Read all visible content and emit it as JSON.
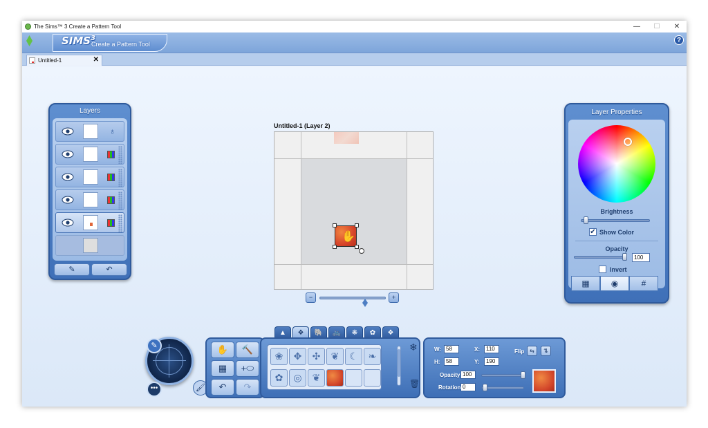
{
  "window": {
    "title": "The Sims™ 3 Create a Pattern Tool",
    "minimize": "—",
    "maximize": "☐",
    "close": "✕"
  },
  "header": {
    "logo_sims": "SIMS",
    "logo_sup": "3",
    "logo_sub": "Create a Pattern Tool",
    "help": "?"
  },
  "tabs": [
    {
      "label": "Untitled-1",
      "close": "✕"
    }
  ],
  "layers": {
    "title": "Layers",
    "bottom_buttons": [
      "✎",
      "↶"
    ]
  },
  "canvas": {
    "title": "Untitled-1 (Layer 2)",
    "zoom_out": "−",
    "zoom_in": "+",
    "zoom_level": 0.68
  },
  "layer_properties": {
    "title": "Layer Properties",
    "brightness_label": "Brightness",
    "brightness_value": 0.03,
    "show_color_label": "Show Color",
    "show_color_checked": "✔",
    "opacity_label": "Opacity",
    "opacity_value": "100",
    "invert_label": "Invert",
    "tabs": [
      "▦",
      "◉",
      "#"
    ]
  },
  "toolbar": {
    "dial_pencil": "✎",
    "dial_more": "•••",
    "dial_paint": "🖌",
    "tools": [
      "✋",
      "🔨",
      "▦",
      "+⬭",
      "↶",
      "↷"
    ],
    "category_tabs": [
      "▲",
      "❖",
      "🐘",
      "🚲",
      "❋",
      "✿",
      "❖"
    ],
    "pattern_cells": [
      "❀",
      "✥",
      "✣",
      "❦",
      "☾",
      "❧",
      "✿",
      "◎",
      "❦",
      "",
      "",
      ""
    ],
    "snow": "❄",
    "trash": "🗑"
  },
  "transform": {
    "w_label": "W:",
    "w_value": "58",
    "h_label": "H:",
    "h_value": "58",
    "x_label": "X:",
    "x_value": "110",
    "y_label": "Y:",
    "y_value": "190",
    "flip_label": "Flip",
    "flip_h": "⇆",
    "flip_v": "⇅",
    "opacity_label": "Opacity",
    "opacity_value": "100",
    "rotation_label": "Rotation",
    "rotation_value": "0"
  }
}
